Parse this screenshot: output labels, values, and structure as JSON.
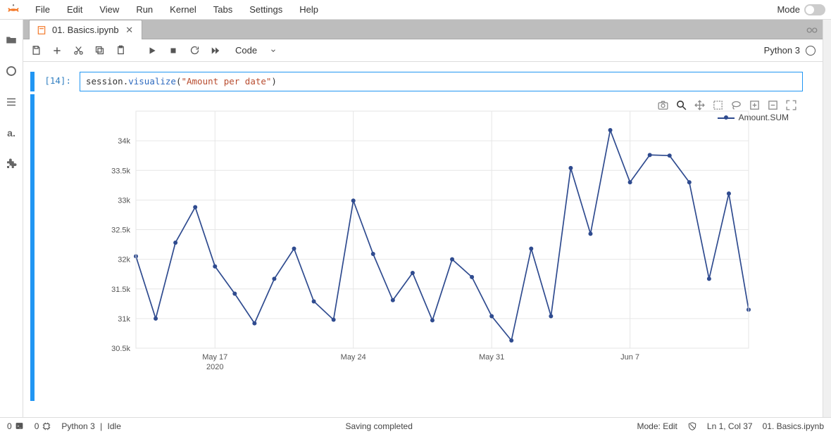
{
  "menu": [
    "File",
    "Edit",
    "View",
    "Run",
    "Kernel",
    "Tabs",
    "Settings",
    "Help"
  ],
  "mode_label": "Mode",
  "tab": {
    "title": "01. Basics.ipynb"
  },
  "toolbar": {
    "cell_type": "Code",
    "kernel_name": "Python 3"
  },
  "cell": {
    "prompt": "[14]:",
    "code_tokens": [
      {
        "t": "session",
        "c": "n"
      },
      {
        "t": ".",
        "c": "p"
      },
      {
        "t": "visualize",
        "c": "f"
      },
      {
        "t": "(",
        "c": "p"
      },
      {
        "t": "\"Amount per date\"",
        "c": "s"
      },
      {
        "t": ")",
        "c": "p"
      }
    ]
  },
  "chart_data": {
    "type": "line",
    "title": "",
    "xlabel": "",
    "ylabel": "",
    "x_axis_year": "2020",
    "x_tick_labels": [
      "May 17",
      "May 24",
      "May 31",
      "Jun 7"
    ],
    "x_tick_indices": [
      4,
      11,
      18,
      25
    ],
    "ylim": [
      30500,
      34500
    ],
    "y_ticks": [
      30500,
      31000,
      31500,
      32000,
      32500,
      33000,
      33500,
      34000
    ],
    "y_tick_labels": [
      "30.5k",
      "31k",
      "31.5k",
      "32k",
      "32.5k",
      "33k",
      "33.5k",
      "34k"
    ],
    "series": [
      {
        "name": "Amount.SUM",
        "values": [
          32050,
          31000,
          32280,
          32880,
          31880,
          31420,
          30920,
          31670,
          32180,
          31290,
          30980,
          32990,
          32090,
          31310,
          31770,
          30970,
          32000,
          31700,
          31040,
          30630,
          32180,
          31040,
          33540,
          32430,
          34180,
          33300,
          33760,
          33750,
          33300,
          31670,
          33110,
          31150
        ]
      }
    ]
  },
  "legend_label": "Amount.SUM",
  "status": {
    "left_terms": "0",
    "left_terms_2": "0",
    "kernel": "Python 3",
    "kernel_state": "Idle",
    "center": "Saving completed",
    "mode": "Mode: Edit",
    "cursor": "Ln 1, Col 37",
    "file": "01. Basics.ipynb"
  }
}
